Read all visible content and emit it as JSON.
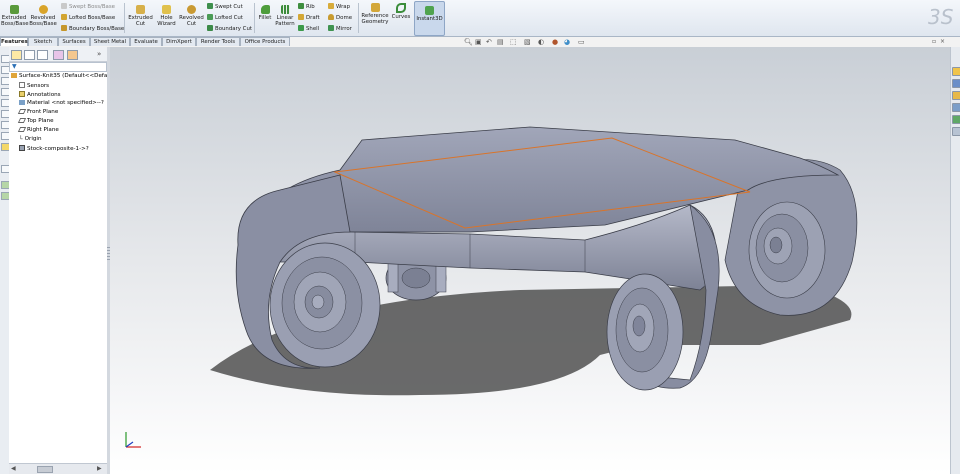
{
  "ribbon": {
    "extruded_boss": "Extruded Boss/Base",
    "revolved_boss": "Revolved Boss/Base",
    "swept_boss": "Swept Boss/Base",
    "lofted_boss": "Lofted Boss/Base",
    "boundary_boss": "Boundary Boss/Base",
    "extruded_cut": "Extruded Cut",
    "hole_wizard": "Hole Wizard",
    "revolved_cut": "Revolved Cut",
    "swept_cut": "Swept Cut",
    "lofted_cut": "Lofted Cut",
    "boundary_cut": "Boundary Cut",
    "fillet": "Fillet",
    "linear_pattern": "Linear Pattern",
    "rib": "Rib",
    "draft": "Draft",
    "shell": "Shell",
    "wrap": "Wrap",
    "dome": "Dome",
    "mirror": "Mirror",
    "reference_geometry": "Reference Geometry",
    "curves": "Curves",
    "instant3d": "Instant3D"
  },
  "tabs": [
    "Features",
    "Sketch",
    "Surfaces",
    "Sheet Metal",
    "Evaluate",
    "DimXpert",
    "Render Tools",
    "Office Products"
  ],
  "tree": {
    "root": "Surface-Knit35  (Default<<Defa",
    "items": [
      "Sensors",
      "Annotations",
      "Material <not specified>--?",
      "Front Plane",
      "Top Plane",
      "Right Plane",
      "Origin",
      "Stock-composite-1->?"
    ]
  },
  "colors": {
    "ribbon_bg": "#e6ecf3",
    "model_body": "#8e93a6",
    "selection_edge": "#d9742a",
    "viewport_top": "#c9cfd6"
  }
}
